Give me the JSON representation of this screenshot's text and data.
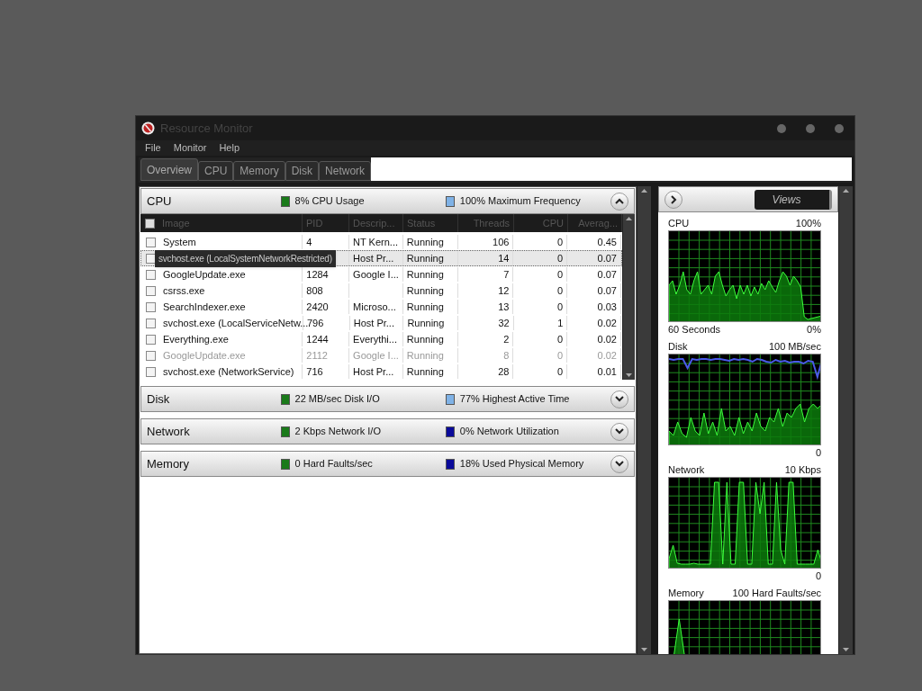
{
  "window": {
    "title": "Resource Monitor"
  },
  "menu": [
    "File",
    "Monitor",
    "Help"
  ],
  "tabs": [
    {
      "label": "Overview",
      "selected": true
    },
    {
      "label": "CPU",
      "selected": false
    },
    {
      "label": "Memory",
      "selected": false
    },
    {
      "label": "Disk",
      "selected": false
    },
    {
      "label": "Network",
      "selected": false
    }
  ],
  "sections": [
    {
      "title": "CPU",
      "expanded": true,
      "metrics": [
        {
          "text": "8% CPU Usage",
          "color": "#1a7a1a"
        },
        {
          "text": "100% Maximum Frequency",
          "color": "#7fb2e6"
        }
      ]
    },
    {
      "title": "Disk",
      "expanded": false,
      "metrics": [
        {
          "text": "22 MB/sec Disk I/O",
          "color": "#1a7a1a"
        },
        {
          "text": "77% Highest Active Time",
          "color": "#7fb2e6"
        }
      ]
    },
    {
      "title": "Network",
      "expanded": false,
      "metrics": [
        {
          "text": "2 Kbps Network I/O",
          "color": "#1a7a1a"
        },
        {
          "text": "0% Network Utilization",
          "color": "#0a0a9a"
        }
      ]
    },
    {
      "title": "Memory",
      "expanded": false,
      "metrics": [
        {
          "text": "0 Hard Faults/sec",
          "color": "#1a7a1a"
        },
        {
          "text": "18% Used Physical Memory",
          "color": "#0a0a9a"
        }
      ]
    }
  ],
  "process_table": {
    "columns": [
      "Image",
      "PID",
      "Descrip...",
      "Status",
      "Threads",
      "CPU",
      "Averag..."
    ],
    "rows": [
      {
        "checked": false,
        "selected": false,
        "dimmed": false,
        "image": "System",
        "pid": "4",
        "description": "NT Kern...",
        "status": "Running",
        "threads": "106",
        "cpu": "0",
        "average": "0.45"
      },
      {
        "checked": false,
        "selected": true,
        "dimmed": false,
        "description": "Host Pr...",
        "status": "Running",
        "threads": "14",
        "cpu": "0",
        "average": "0.07"
      },
      {
        "checked": false,
        "selected": false,
        "dimmed": false,
        "image": "GoogleUpdate.exe",
        "pid": "1284",
        "description": "Google I...",
        "status": "Running",
        "threads": "7",
        "cpu": "0",
        "average": "0.07"
      },
      {
        "checked": false,
        "selected": false,
        "dimmed": false,
        "image": "csrss.exe",
        "pid": "808",
        "status": "Running",
        "threads": "12",
        "cpu": "0",
        "average": "0.07"
      },
      {
        "checked": false,
        "selected": false,
        "dimmed": false,
        "image": "SearchIndexer.exe",
        "pid": "2420",
        "description": "Microso...",
        "status": "Running",
        "threads": "13",
        "cpu": "0",
        "average": "0.03"
      },
      {
        "checked": false,
        "selected": false,
        "dimmed": false,
        "image": "svchost.exe (LocalServiceNetw...",
        "pid": "796",
        "description": "Host Pr...",
        "status": "Running",
        "threads": "32",
        "cpu": "1",
        "average": "0.02"
      },
      {
        "checked": false,
        "selected": false,
        "dimmed": false,
        "image": "Everything.exe",
        "pid": "1244",
        "description": "Everythi...",
        "status": "Running",
        "threads": "2",
        "cpu": "0",
        "average": "0.02"
      },
      {
        "checked": false,
        "selected": false,
        "dimmed": true,
        "image": "GoogleUpdate.exe",
        "pid": "2112",
        "description": "Google I...",
        "status": "Running",
        "threads": "8",
        "cpu": "0",
        "average": "0.02"
      },
      {
        "checked": false,
        "selected": false,
        "dimmed": false,
        "image": "svchost.exe (NetworkService)",
        "pid": "716",
        "description": "Host Pr...",
        "status": "Running",
        "threads": "28",
        "cpu": "0",
        "average": "0.01"
      }
    ],
    "tooltip": "svchost.exe (LocalSystemNetworkRestricted)",
    "select_all_checked": false
  },
  "graphs_panel": {
    "views_button": "Views",
    "graphs": [
      {
        "title": "CPU",
        "max": "100%",
        "time": "60 Seconds",
        "min": "0%"
      },
      {
        "title": "Disk",
        "max": "100 MB/sec",
        "min": "0"
      },
      {
        "title": "Network",
        "max": "10 Kbps",
        "min": "0"
      },
      {
        "title": "Memory",
        "max": "100 Hard Faults/sec"
      }
    ]
  }
}
